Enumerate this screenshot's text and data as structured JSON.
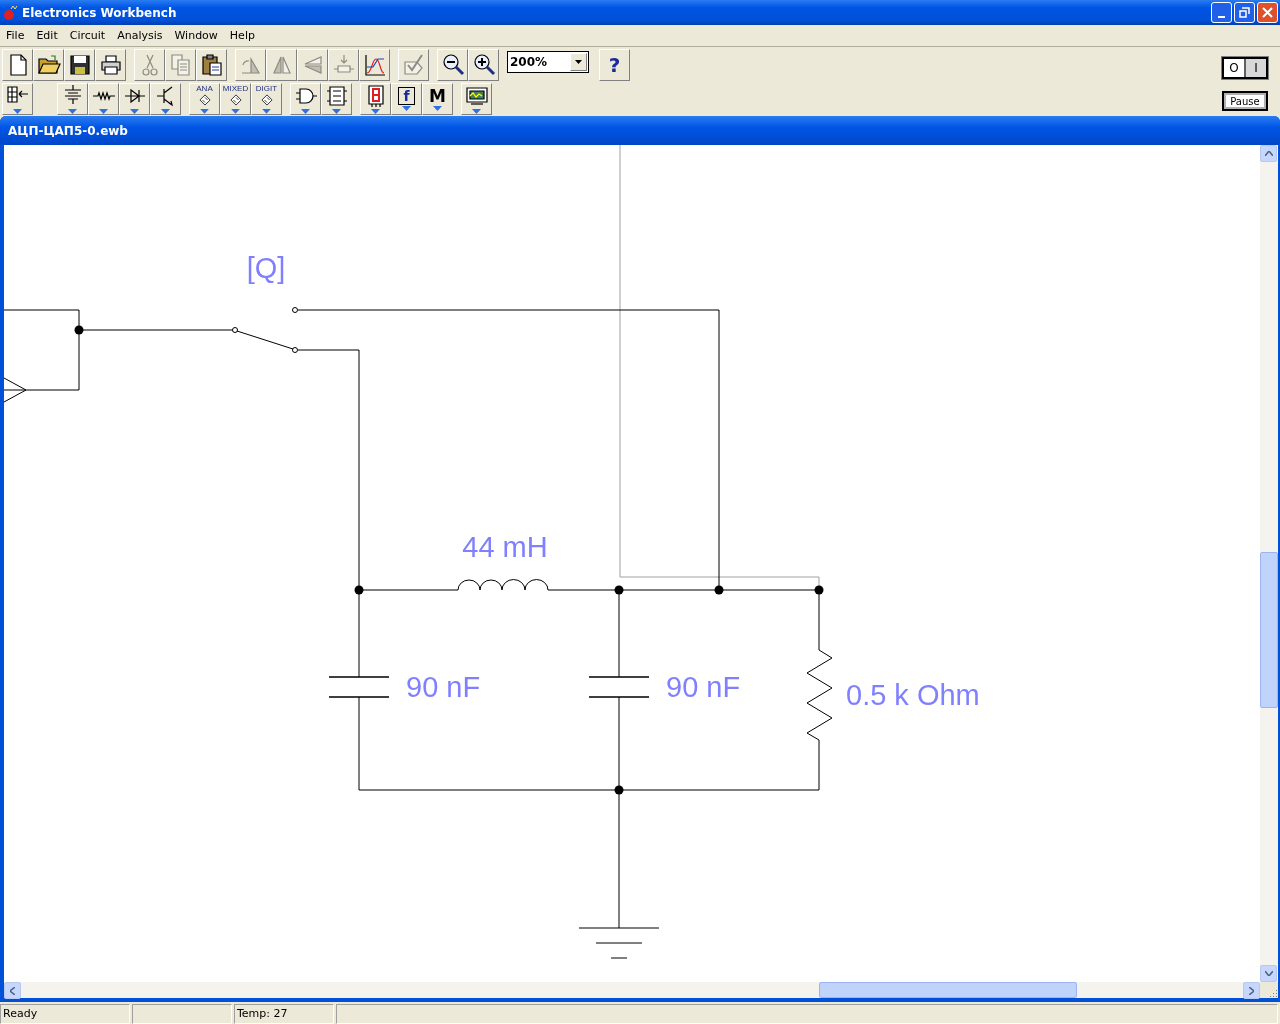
{
  "window": {
    "title": "Electronics Workbench"
  },
  "menu": [
    "File",
    "Edit",
    "Circuit",
    "Analysis",
    "Window",
    "Help"
  ],
  "toolbar": {
    "rows": [
      {
        "groups": [
          {
            "buttons": [
              {
                "kind": "new",
                "disabled": false
              },
              {
                "kind": "open",
                "disabled": false
              },
              {
                "kind": "save",
                "disabled": false
              },
              {
                "kind": "print",
                "disabled": false
              }
            ]
          },
          {
            "buttons": [
              {
                "kind": "cut",
                "disabled": true
              },
              {
                "kind": "copy",
                "disabled": true
              },
              {
                "kind": "paste",
                "disabled": false
              }
            ]
          },
          {
            "buttons": [
              {
                "kind": "rotate",
                "disabled": true
              },
              {
                "kind": "flip-h",
                "disabled": true
              },
              {
                "kind": "flip-v",
                "disabled": true
              },
              {
                "kind": "properties",
                "disabled": true
              },
              {
                "kind": "graph",
                "disabled": false
              }
            ]
          },
          {
            "buttons": [
              {
                "kind": "check",
                "disabled": true
              }
            ]
          },
          {
            "buttons": [
              {
                "kind": "zoom-out",
                "disabled": false
              },
              {
                "kind": "zoom-in",
                "disabled": false
              }
            ]
          },
          {
            "buttons": [
              {
                "kind": "zoom-combo",
                "value": "200%"
              }
            ]
          },
          {
            "buttons": [
              {
                "kind": "help",
                "label": "?",
                "disabled": false
              }
            ]
          }
        ]
      },
      {
        "groups": [
          {
            "buttons": [
              {
                "kind": "parts-bin",
                "disabled": false,
                "menu": true
              }
            ]
          },
          {
            "buttons": [
              {
                "kind": "sources",
                "disabled": false,
                "menu": true
              },
              {
                "kind": "basic",
                "disabled": false,
                "menu": true
              },
              {
                "kind": "diode",
                "disabled": false,
                "menu": true
              },
              {
                "kind": "transistor",
                "disabled": false,
                "menu": true
              }
            ]
          },
          {
            "buttons": [
              {
                "kind": "chip",
                "label": "ANA",
                "disabled": false,
                "menu": true
              },
              {
                "kind": "chip",
                "label": "MIXED",
                "disabled": false,
                "menu": true
              },
              {
                "kind": "chip",
                "label": "DIGIT",
                "disabled": false,
                "menu": true
              }
            ]
          },
          {
            "buttons": [
              {
                "kind": "gate",
                "disabled": false,
                "menu": true
              },
              {
                "kind": "flipflop",
                "disabled": false,
                "menu": true
              }
            ]
          },
          {
            "buttons": [
              {
                "kind": "indicator",
                "disabled": false,
                "menu": true
              },
              {
                "kind": "control",
                "label": "f",
                "disabled": false,
                "menu": true
              },
              {
                "kind": "misc",
                "label": "M",
                "disabled": false,
                "menu": true
              }
            ]
          },
          {
            "buttons": [
              {
                "kind": "instruments",
                "disabled": false,
                "menu": true
              }
            ]
          }
        ]
      }
    ]
  },
  "power_switch": {
    "off_label": "O",
    "on_label": "I",
    "on": true
  },
  "pause_button": "Pause",
  "document": {
    "title": "АЦП-ЦАП5-0.ewb"
  },
  "schematic": {
    "switch_label": "[Q]",
    "inductor_label": "44 mH",
    "capacitor_labels": [
      "90 nF",
      "90 nF"
    ],
    "resistor_label": "0.5 k Ohm"
  },
  "status_bar": {
    "message": "Ready",
    "temperature": "Temp: 27"
  }
}
